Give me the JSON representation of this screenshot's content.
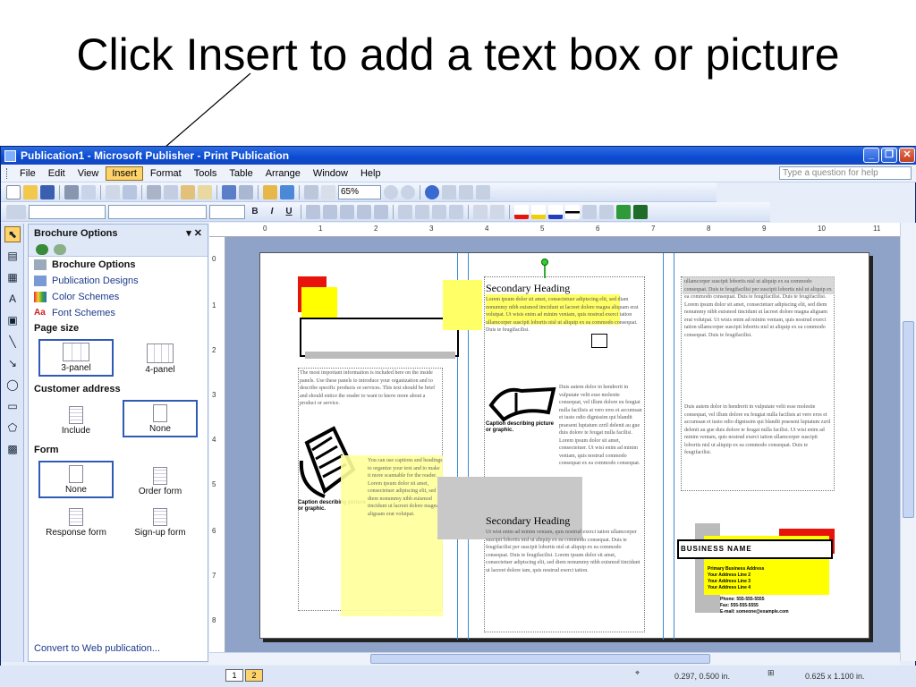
{
  "slide": {
    "title": "Click Insert to add a text box or picture"
  },
  "window": {
    "title": "Publication1 - Microsoft Publisher - Print Publication",
    "controls": {
      "minimize": "_",
      "restore": "❐",
      "close": "✕"
    }
  },
  "menu": {
    "items": [
      "File",
      "Edit",
      "View",
      "Insert",
      "Format",
      "Tools",
      "Table",
      "Arrange",
      "Window",
      "Help"
    ],
    "active": "Insert",
    "ask_placeholder": "Type a question for help"
  },
  "toolbar": {
    "zoom": "65%"
  },
  "format_toolbar": {
    "bold": "B",
    "italic": "I",
    "underline": "U"
  },
  "taskpane": {
    "title": "Brochure Options",
    "links": [
      "Brochure Options",
      "Publication Designs",
      "Color Schemes",
      "Font Schemes"
    ],
    "page_size": {
      "label": "Page size",
      "options": [
        "3-panel",
        "4-panel"
      ],
      "selected": "3-panel"
    },
    "customer_address": {
      "label": "Customer address",
      "options": [
        "Include",
        "None"
      ],
      "selected": "None"
    },
    "form": {
      "label": "Form",
      "options": [
        "None",
        "Order form",
        "Response form",
        "Sign-up form"
      ],
      "selected": "None"
    },
    "footer_link": "Convert to Web publication..."
  },
  "ruler": {
    "h_ticks": [
      "0",
      "1",
      "2",
      "3",
      "4",
      "5",
      "6",
      "7",
      "8",
      "9",
      "10",
      "11"
    ],
    "v_ticks": [
      "0",
      "1",
      "2",
      "3",
      "4",
      "5",
      "6",
      "7",
      "8"
    ]
  },
  "document": {
    "heading1": "Secondary Heading",
    "heading2": "Secondary Heading",
    "caption1": "Caption describing picture or graphic.",
    "caption2": "Caption describing picture or graphic.",
    "business_name": "BUSINESS NAME",
    "address_lines": [
      "Primary Business Address",
      "Your Address Line 2",
      "Your Address Line 3",
      "Your Address Line 4"
    ],
    "contact": [
      "Phone: 555-555-5555",
      "Fax: 555-555-5555",
      "E-mail: someone@example.com"
    ],
    "col1_text": "The most important information is included here on the inside panels. Use these panels to introduce your organization and to describe specific products or services. This text should be brief and should entice the reader to want to know more about a product or service.",
    "col1_text2": "You can use captions and headings to organize your text and to make it more scannable for the reader. Lorem ipsum dolor sit amet, consectetuer adipiscing elit, sed diem nonummy nibh euismod tincidunt ut lacreet dolore magna aliguam erat volutpat.",
    "col2_text": "Lorem ipsum dolor sit amet, consectetuer adipiscing elit, sed diam nonummy nibh euismod tincidunt ut lacreet dolore magna aliquam erat volutpat. Ut wisis enim ad minim veniam, quis nostrud exerci tation ullamcorper suscipit lobortis nisl ut aliquip ex ea commodo consequat. Duis te feugifacilisi.",
    "col2_text2": "Duis autem dolor in hendrerit in vulputate velit esse molestie consequat, vel illum dolore eu feugiat nulla facilisis at vero eros et accumsan et iusto odio dignissim qui blandit praesent luptatum zzril delenit au gue duis dolore te feugat nulla facilisi. Lorem ipsum dolor sit amet, consectetuer. Ut wisi enim ad minim veniam, quis nostrud commodo consequat ex ea commodo consequat.",
    "col2_text3": "Ut wisi enim ad minim veniam, quis nostrud exerci tation ullamcorper suscipit lobortis nisl ut aliquip ex ea commodo consequat. Duis te feugifacilisi per suscipit lobortis nisl ut aliquip ex ea commodo consequat. Duis te feugifacilisi. Lorem ipsum dolor sit amet, consectetuer adipiscing elit, sed diem nonummy nibh euismod tincidunt ut lacreet dolore iam, quis nostrud exerci tation.",
    "col3_text": "ullamcorper suscipit lobortis nisl ut aliquip ex ea commodo consequat. Duis te feugifacilisi per suscipit lobortis nisl ut aliquip ex ea commodo consequat. Duis te feugifacilisi. Duis te feugifacilisi. Lorem ipsum dolor sit amet, consectetuer adipiscing elit, sed diem nonummy nibh euismod tincidunt ut lacreet dolore magna aliguam erat volutpat. Ut wisis enim ad minim veniam, quis nostrud exerci tation ullamcorper suscipit lobortis nisl ut aliquip ex ea commodo consequat. Duis te feugifacilisi.",
    "col3_text2": "Duis autem dolor in hendrerit in vulputate velit esse molestie consequat, vel illum dolore eu feugiat nulla facilisis at vero eros et accumsan et iusto odio dignissim qui blandit praesent luptatum zzril delenit au gue duis dolore te feugat nulla facilisi. Ut wisi enim ad minim veniam, quis nostrud exerci tation ullamcorper suscipit lobortis nisl ut aliquip ex ea commodo consequat. Duis te feugifacilisi."
  },
  "status": {
    "pages": [
      "1",
      "2"
    ],
    "active_page": "2",
    "position": "0.297, 0.500 in.",
    "size": "0.625 x 1.100 in."
  },
  "colors": {
    "accent_red": "#e8140c",
    "accent_yellow": "#ffff00",
    "xp_blue": "#0b4bd2",
    "menu_highlight": "#ffd36b"
  }
}
